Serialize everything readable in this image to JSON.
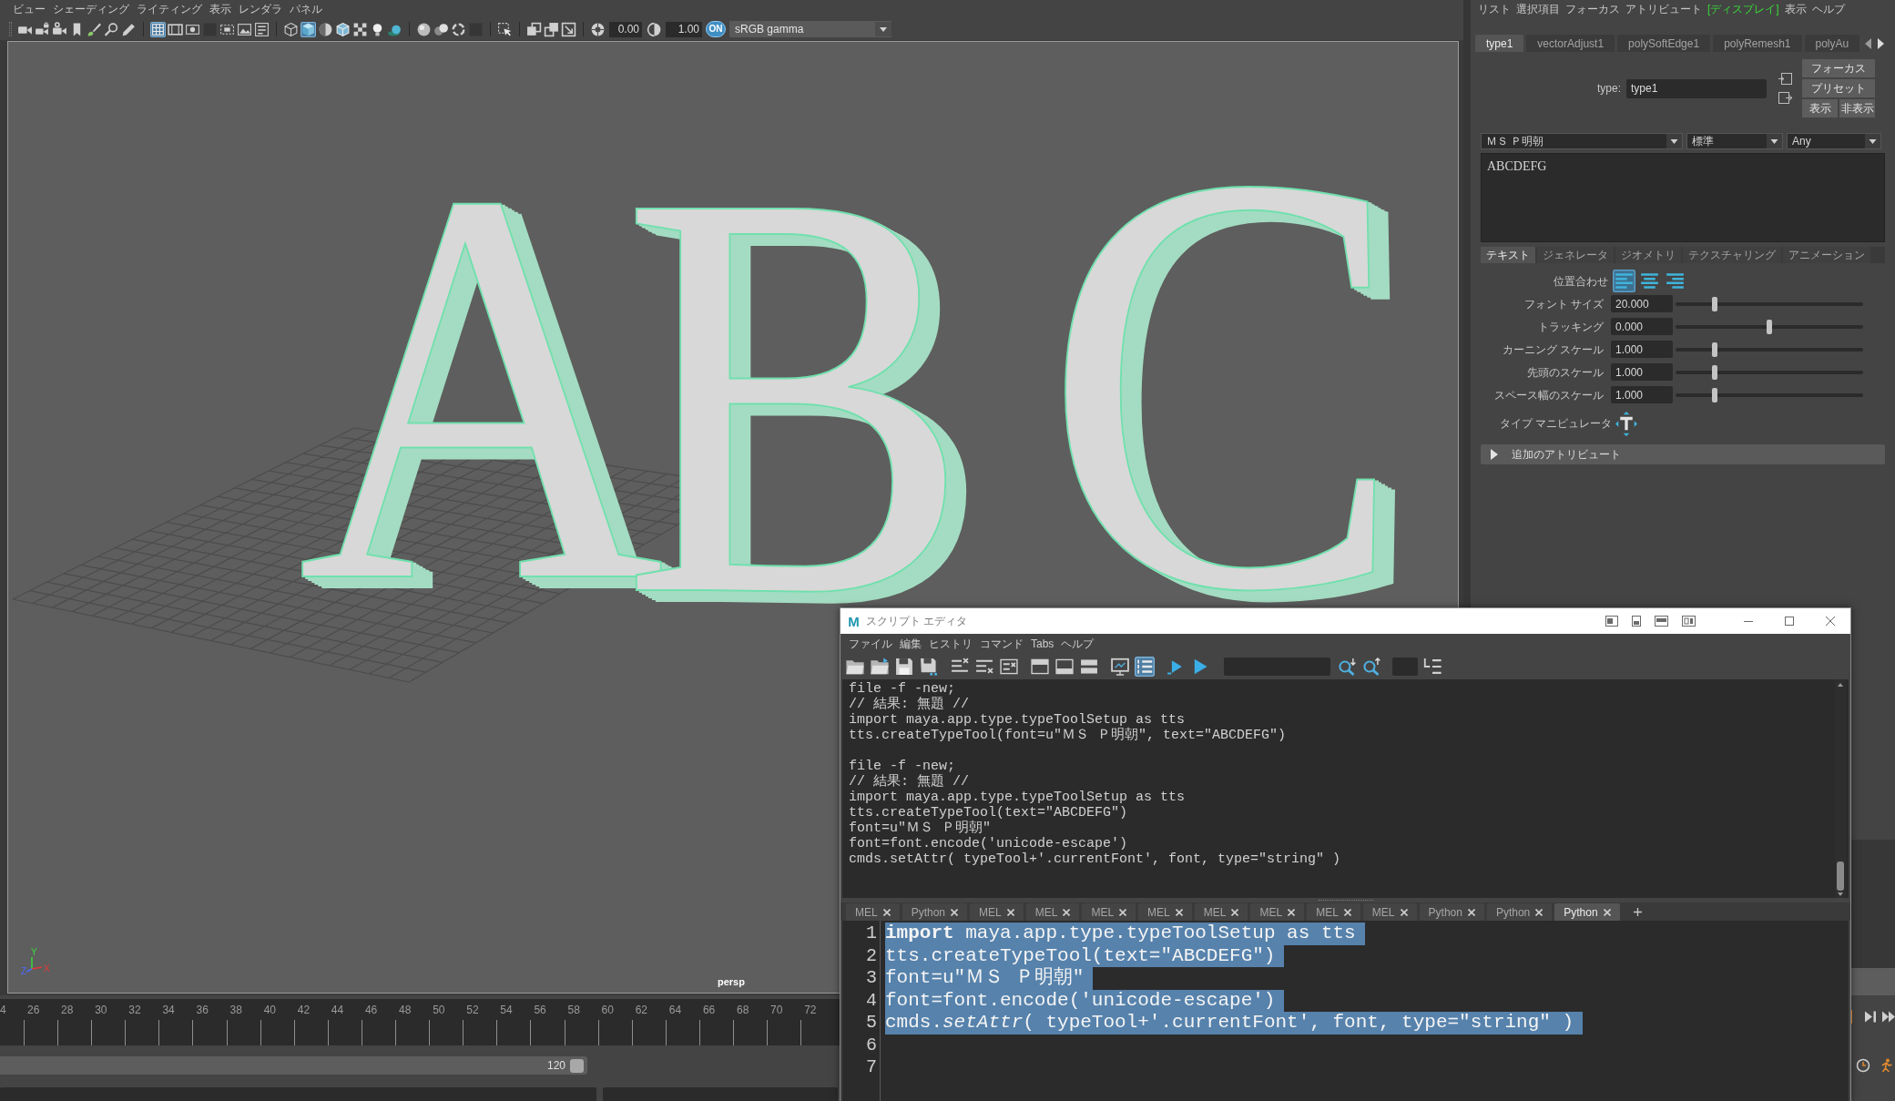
{
  "viewport_panel": {
    "menu": [
      "ビュー",
      "シェーディング",
      "ライティング",
      "表示",
      "レンダラ",
      "パネル"
    ],
    "toolbar": {
      "buttons": [
        {
          "selected": false
        },
        {
          "selected": false
        },
        {
          "selected": false
        },
        {
          "selected": false
        },
        {
          "selected": false
        },
        {
          "selected": false
        },
        {
          "selected": false
        },
        {
          "selected": true
        },
        {
          "selected": false
        },
        {
          "selected": false
        },
        {
          "selected": false
        },
        {
          "selected": false
        },
        {
          "selected": false
        },
        {
          "selected": false
        },
        {
          "selected": false
        },
        {
          "selected": true
        },
        {
          "selected": false
        },
        {
          "selected": false
        },
        {
          "selected": false
        },
        {
          "selected": false
        },
        {
          "selected": false
        },
        {
          "selected": false
        },
        {
          "selected": false
        },
        {
          "selected": false
        },
        {
          "selected": false
        },
        {
          "selected": false
        },
        {
          "selected": false
        },
        {
          "selected": false
        },
        {
          "selected": false
        }
      ],
      "exposure": "0.00",
      "gamma": "1.00",
      "color_management": {
        "label": "ON",
        "on": true
      },
      "view_transform": "sRGB gamma"
    },
    "scene": {
      "model_text": "ABC",
      "axis_labels": [
        "Y",
        "Z",
        "X"
      ],
      "camera": "persp"
    }
  },
  "attribute_editor": {
    "menu": [
      {
        "label": "リスト",
        "selected": false
      },
      {
        "label": "選択項目",
        "selected": false
      },
      {
        "label": "フォーカス",
        "selected": false
      },
      {
        "label": "アトリビュート",
        "selected": false
      },
      {
        "label": "[ディスプレイ]",
        "selected": true
      },
      {
        "label": "表示",
        "selected": false
      },
      {
        "label": "ヘルプ",
        "selected": false
      }
    ],
    "node_tabs": [
      {
        "label": "type1",
        "selected": true
      },
      {
        "label": "vectorAdjust1",
        "selected": false
      },
      {
        "label": "polySoftEdge1",
        "selected": false
      },
      {
        "label": "polyRemesh1",
        "selected": false
      },
      {
        "label": "polyAu",
        "selected": false
      }
    ],
    "node": {
      "label": "type:",
      "value": "type1"
    },
    "side_buttons": [
      "フォーカス",
      "プリセット",
      "表示",
      "非表示"
    ],
    "font": {
      "family": "ＭＳ Ｐ明朝",
      "style": "標準",
      "writing_system": "Any"
    },
    "text": "ABCDEFG",
    "section_tabs": [
      {
        "label": "テキスト",
        "selected": true
      },
      {
        "label": "ジェネレータ",
        "selected": false
      },
      {
        "label": "ジオメトリ",
        "selected": false
      },
      {
        "label": "テクスチャリング",
        "selected": false
      },
      {
        "label": "アニメーション",
        "selected": false
      }
    ],
    "alignment": {
      "label": "位置合わせ",
      "options": [
        {
          "selected": true
        },
        {
          "selected": false
        },
        {
          "selected": false
        }
      ]
    },
    "sliders": [
      {
        "label": "フォント サイズ",
        "value": "20.000",
        "level": 0.21
      },
      {
        "label": "トラッキング",
        "value": "0.000",
        "level": 0.5
      },
      {
        "label": "カーニング スケール",
        "value": "1.000",
        "level": 0.21
      },
      {
        "label": "先頭のスケール",
        "value": "1.000",
        "level": 0.21
      },
      {
        "label": "スペース幅のスケール",
        "value": "1.000",
        "level": 0.21
      }
    ],
    "manipulator_label": "タイプ マニピュレータ",
    "extra_section": {
      "label": "追加のアトリビュート",
      "expanded": false
    }
  },
  "time_slider": {
    "frames": [
      "4",
      "26",
      "28",
      "30",
      "32",
      "34",
      "36",
      "38",
      "40",
      "42",
      "44",
      "46",
      "48",
      "50",
      "52",
      "54",
      "56",
      "58",
      "60",
      "62",
      "64",
      "66",
      "68",
      "70",
      "72"
    ]
  },
  "range_slider": {
    "end": "120"
  },
  "script_editor": {
    "logo": "M",
    "title": "スクリプト エディタ",
    "menu": [
      "ファイル",
      "編集",
      "ヒストリ",
      "コマンド",
      "Tabs",
      "ヘルプ"
    ],
    "toolbar": {
      "buttons": [
        {
          "selected": false
        },
        {
          "selected": false
        },
        {
          "selected": false
        },
        {
          "selected": false
        },
        {
          "selected": false
        },
        {
          "selected": false
        },
        {
          "selected": false
        },
        {
          "selected": false
        },
        {
          "selected": false
        },
        {
          "selected": false
        },
        {
          "selected": false
        },
        {
          "selected": true
        },
        {
          "selected": false
        },
        {
          "selected": false
        },
        {
          "selected": false
        },
        {
          "selected": false
        },
        {
          "selected": false
        }
      ]
    },
    "output": [
      [
        "file -f -new;",
        "// 結果: 無題 //",
        "import maya.app.type.typeToolSetup as tts",
        "tts.createTypeTool(font=u\"ＭＳ Ｐ明朝\", text=\"ABCDEFG\")"
      ],
      [
        "file -f -new;",
        "// 結果: 無題 //",
        "import maya.app.type.typeToolSetup as tts",
        "tts.createTypeTool(text=\"ABCDEFG\")",
        "font=u\"ＭＳ Ｐ明朝\"",
        "font=font.encode('unicode-escape')",
        "cmds.setAttr( typeTool+'.currentFont', font, type=\"string\" )"
      ]
    ],
    "tabs": [
      {
        "label": "MEL",
        "selected": false
      },
      {
        "label": "Python",
        "selected": false
      },
      {
        "label": "MEL",
        "selected": false
      },
      {
        "label": "MEL",
        "selected": false
      },
      {
        "label": "MEL",
        "selected": false
      },
      {
        "label": "MEL",
        "selected": false
      },
      {
        "label": "MEL",
        "selected": false
      },
      {
        "label": "MEL",
        "selected": false
      },
      {
        "label": "MEL",
        "selected": false
      },
      {
        "label": "MEL",
        "selected": false
      },
      {
        "label": "Python",
        "selected": false
      },
      {
        "label": "Python",
        "selected": false
      },
      {
        "label": "Python",
        "selected": true
      }
    ],
    "input": [
      {
        "number": "1",
        "code": "**import** maya.app.type.typeToolSetup as tts",
        "selected": true
      },
      {
        "number": "2",
        "code": "tts.createTypeTool(text=\"ABCDEFG\")",
        "selected": true
      },
      {
        "number": "3",
        "code": "font=u\"ＭＳ Ｐ明朝\"",
        "selected": true
      },
      {
        "number": "4",
        "code": "font=font.encode('unicode-escape')",
        "selected": true
      },
      {
        "number": "5",
        "code": "cmds.*setAttr*( typeTool+'.currentFont', font, type=\"string\" )",
        "selected": true
      },
      {
        "number": "6",
        "selected": false
      },
      {
        "number": "7",
        "selected": false
      }
    ]
  }
}
